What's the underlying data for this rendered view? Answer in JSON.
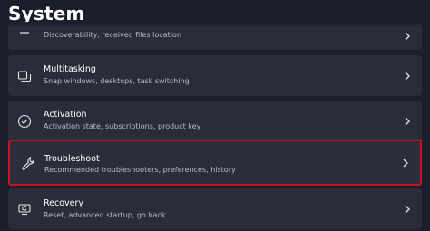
{
  "header": {
    "title": "System"
  },
  "settings": {
    "items": [
      {
        "title": "",
        "subtitle": "Discoverability, received files location",
        "icon": "nearby-sharing-icon"
      },
      {
        "title": "Multitasking",
        "subtitle": "Snap windows, desktops, task switching",
        "icon": "multitasking-icon"
      },
      {
        "title": "Activation",
        "subtitle": "Activation state, subscriptions, product key",
        "icon": "checkmark-circle-icon"
      },
      {
        "title": "Troubleshoot",
        "subtitle": "Recommended troubleshooters, preferences, history",
        "icon": "wrench-icon"
      },
      {
        "title": "Recovery",
        "subtitle": "Reset, advanced startup, go back",
        "icon": "recovery-icon"
      }
    ]
  },
  "colors": {
    "background": "#1c1f2b",
    "card": "#2a2d39",
    "highlight": "#c4151f"
  }
}
